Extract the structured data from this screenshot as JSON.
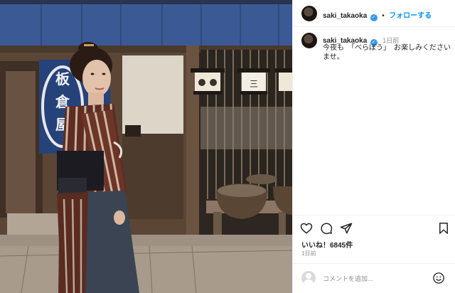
{
  "post": {
    "username": "saki_takaoka",
    "follow_label": "フォローする",
    "separator": "•",
    "verified_mark": "✓",
    "caption_time": "1日前",
    "caption_text": "今夜も　「べらぼう」　お楽しみください ませ。",
    "likes": "いいね！6845件",
    "posted_ago": "1日前",
    "comment_placeholder": "コメントを追加...",
    "noren_text": "板倉屋"
  },
  "icons": {
    "like": "heart-icon",
    "comment": "comment-icon",
    "share": "paper-plane-icon",
    "save": "bookmark-icon",
    "emoji": "smiley-icon"
  },
  "colors": {
    "link": "#0095f6",
    "verified": "#3897f0",
    "text": "#262626",
    "muted": "#8e8e8e"
  }
}
